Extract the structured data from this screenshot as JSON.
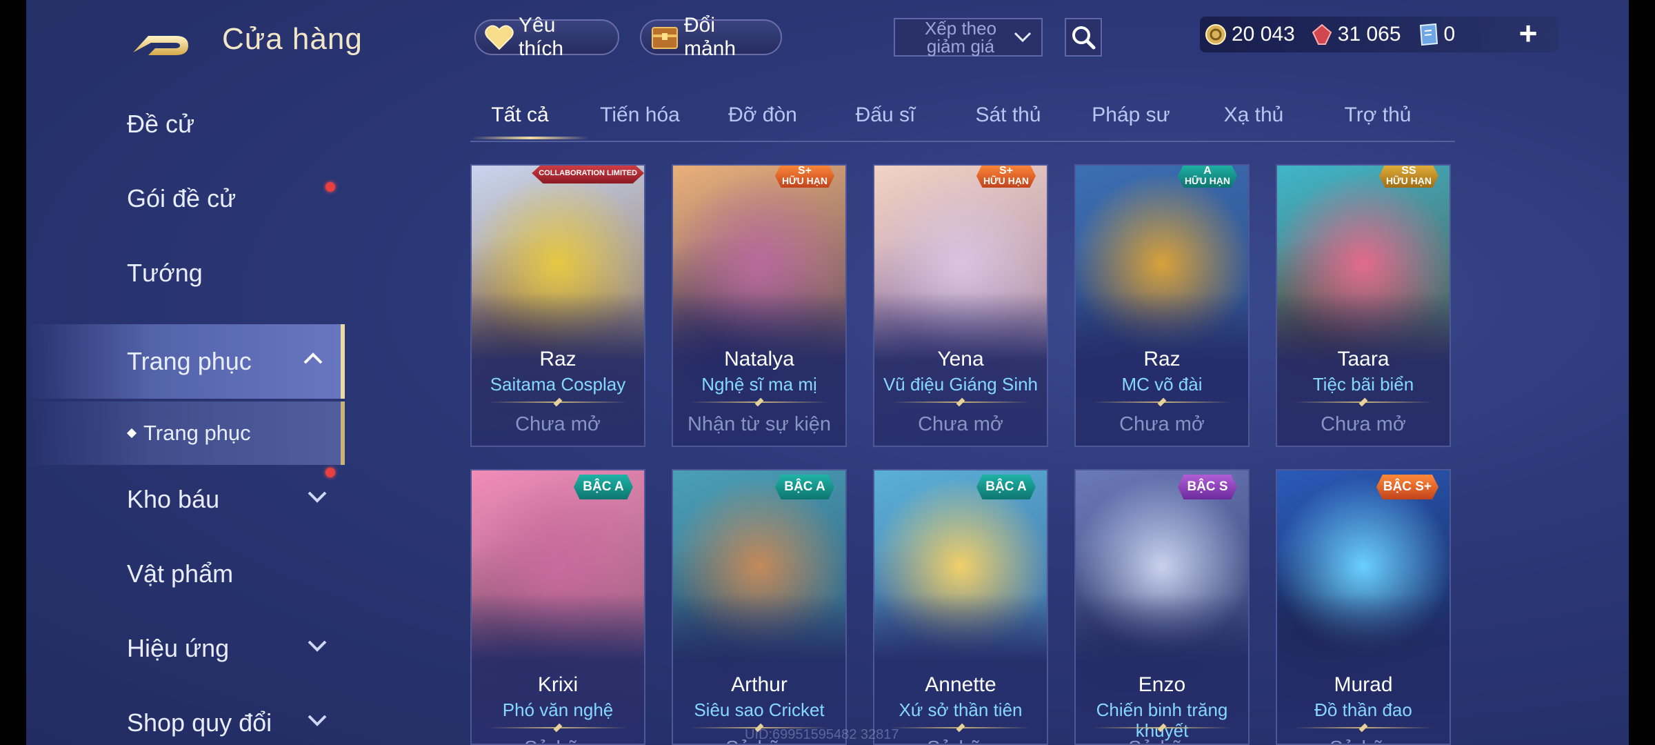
{
  "header": {
    "title": "Cửa hàng",
    "favorite_label": "Yêu thích",
    "exchange_label": "Đổi mảnh",
    "sort_label": "Xếp theo giảm giá"
  },
  "currencies": [
    {
      "icon": "gold-coin-icon",
      "value": "20 043"
    },
    {
      "icon": "ruby-gem-icon",
      "value": "31 065"
    },
    {
      "icon": "voucher-icon",
      "value": "0"
    }
  ],
  "sidebar": {
    "items": [
      {
        "label": "Đề cử"
      },
      {
        "label": "Gói đề cử"
      },
      {
        "label": "Tướng"
      },
      {
        "label": "Trang phục"
      },
      {
        "label": "Trang phục"
      },
      {
        "label": "Kho báu"
      },
      {
        "label": "Vật phẩm"
      },
      {
        "label": "Hiệu ứng"
      },
      {
        "label": "Shop quy đổi"
      }
    ]
  },
  "tabs": [
    {
      "label": "Tất cả"
    },
    {
      "label": "Tiến hóa"
    },
    {
      "label": "Đỡ đòn"
    },
    {
      "label": "Đấu sĩ"
    },
    {
      "label": "Sát thủ"
    },
    {
      "label": "Pháp sư"
    },
    {
      "label": "Xạ thủ"
    },
    {
      "label": "Trợ thủ"
    }
  ],
  "cards": [
    {
      "hero": "Raz",
      "skin": "Saitama Cosplay",
      "status": "Chưa mở",
      "badge": "COLLABORATION LIMITED",
      "colors": [
        "#c9d4ee",
        "#e7c843",
        "#7d5a3a"
      ]
    },
    {
      "hero": "Natalya",
      "skin": "Nghệ sĩ ma mị",
      "status": "Nhận từ sự kiện",
      "badge_rank": "S+",
      "badge_sub": "HỮU HẠN",
      "colors": [
        "#e9b07a",
        "#b86a9c",
        "#3a2a58"
      ]
    },
    {
      "hero": "Yena",
      "skin": "Vũ điệu Giáng Sinh",
      "status": "Chưa mở",
      "badge_rank": "S+",
      "badge_sub": "HỮU HẠN",
      "colors": [
        "#f2d3c4",
        "#d9c4e0",
        "#8c6fa0"
      ]
    },
    {
      "hero": "Raz",
      "skin": "MC võ đài",
      "status": "Chưa mở",
      "badge_rank": "A",
      "badge_sub": "HỮU HẠN",
      "colors": [
        "#3b6fb3",
        "#d9a23a",
        "#2a3f78"
      ]
    },
    {
      "hero": "Taara",
      "skin": "Tiệc bãi biển",
      "status": "Chưa mở",
      "badge_rank": "SS",
      "badge_sub": "HỮU HẠN",
      "colors": [
        "#3fb6c9",
        "#e36b8c",
        "#5a3a2a"
      ]
    },
    {
      "hero": "Krixi",
      "skin": "Phó văn nghệ",
      "status": "Sở hữu",
      "badge": "BẬC A",
      "colors": [
        "#f08db8",
        "#c96a9c",
        "#7a4a6a"
      ]
    },
    {
      "hero": "Arthur",
      "skin": "Siêu sao Cricket",
      "status": "Sở hữu",
      "badge": "BẬC A",
      "colors": [
        "#4aa0b8",
        "#c48a5a",
        "#2a4a6a"
      ]
    },
    {
      "hero": "Annette",
      "skin": "Xứ sở thần tiên",
      "status": "Sở hữu",
      "badge": "BẬC A",
      "colors": [
        "#5ab0d8",
        "#f1d06a",
        "#3a5a90"
      ]
    },
    {
      "hero": "Enzo",
      "skin": "Chiến binh trăng khuyết",
      "status": "Sở hữu",
      "badge": "BẬC S",
      "colors": [
        "#6a7ab8",
        "#c8d2ee",
        "#2a3060"
      ]
    },
    {
      "hero": "Murad",
      "skin": "Đồ thần đao",
      "status": "Sở hữu",
      "badge": "BẬC S+",
      "colors": [
        "#2a5ab8",
        "#6ad0ff",
        "#141a40"
      ]
    }
  ],
  "watermark": "UID:69951595482 32817"
}
